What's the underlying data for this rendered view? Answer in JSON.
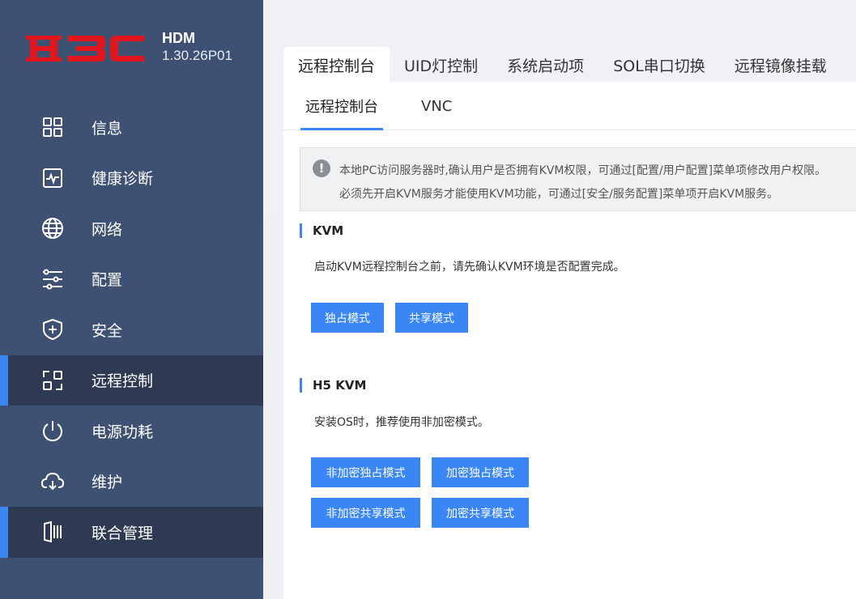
{
  "brand": {
    "logo_text": "H3C",
    "logo_color": "#e4161d",
    "product": "HDM",
    "version": "1.30.26P01"
  },
  "sidebar": {
    "items": [
      {
        "label": "信息",
        "icon": "grid-icon",
        "active": false
      },
      {
        "label": "健康诊断",
        "icon": "heartbeat-icon",
        "active": false
      },
      {
        "label": "网络",
        "icon": "globe-icon",
        "active": false
      },
      {
        "label": "配置",
        "icon": "sliders-icon",
        "active": false
      },
      {
        "label": "安全",
        "icon": "shield-icon",
        "active": false
      },
      {
        "label": "远程控制",
        "icon": "remote-control-icon",
        "active": true
      },
      {
        "label": "电源功耗",
        "icon": "power-icon",
        "active": false
      },
      {
        "label": "维护",
        "icon": "cloud-maintenance-icon",
        "active": false
      },
      {
        "label": "联合管理",
        "icon": "federation-icon",
        "active": true
      }
    ]
  },
  "tabs": [
    "远程控制台",
    "UID灯控制",
    "系统启动项",
    "SOL串口切换",
    "远程镜像挂载"
  ],
  "subtabs": [
    "远程控制台",
    "VNC"
  ],
  "notice": {
    "line1": "本地PC访问服务器时,确认用户是否拥有KVM权限，可通过[配置/用户配置]菜单项修改用户权限。",
    "line2": "必须先开启KVM服务才能使用KVM功能，可通过[安全/服务配置]菜单项开启KVM服务。"
  },
  "kvm": {
    "title": "KVM",
    "desc": "启动KVM远程控制台之前，请先确认KVM环境是否配置完成。",
    "buttons": [
      "独占模式",
      "共享模式"
    ]
  },
  "h5kvm": {
    "title": "H5 KVM",
    "desc": "安装OS时，推荐使用非加密模式。",
    "buttons": [
      "非加密独占模式",
      "加密独占模式",
      "非加密共享模式",
      "加密共享模式"
    ]
  },
  "colors": {
    "sidebar": "#3f5172",
    "sidebar_active": "#2d3a52",
    "accent": "#3a86f5"
  }
}
